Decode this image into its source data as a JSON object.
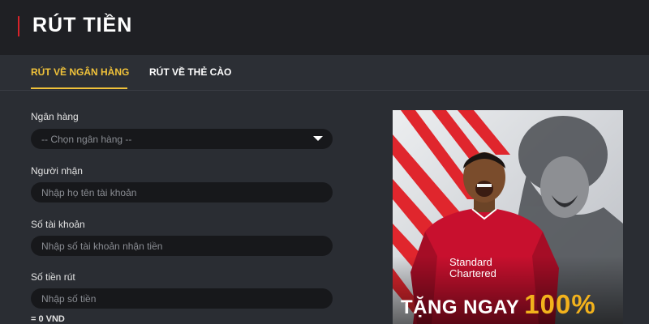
{
  "header": {
    "title": "RÚT TIỀN"
  },
  "tabs": [
    {
      "label": "RÚT VỀ NGÂN HÀNG",
      "active": true
    },
    {
      "label": "RÚT VỀ THẺ CÀO",
      "active": false
    }
  ],
  "form": {
    "bank": {
      "label": "Ngân hàng",
      "selected": "-- Chọn ngân hàng --"
    },
    "recipient": {
      "label": "Người nhận",
      "placeholder": "Nhập họ tên tài khoản",
      "value": ""
    },
    "account_number": {
      "label": "Số tài khoản",
      "placeholder": "Nhập số tài khoản nhận tiền",
      "value": ""
    },
    "amount": {
      "label": "Số tiền rút",
      "placeholder": "Nhập số tiền",
      "value": ""
    },
    "converted": "= 0 VND"
  },
  "banner": {
    "text_main": "TẶNG NGAY",
    "text_percent": "100%",
    "shirt_sponsor_line1": "Standard",
    "shirt_sponsor_line2": "Chartered"
  },
  "colors": {
    "accent_yellow": "#f0c23a",
    "accent_red": "#d8232a",
    "field_bg": "#17181b",
    "page_bg": "#2a2d33"
  }
}
